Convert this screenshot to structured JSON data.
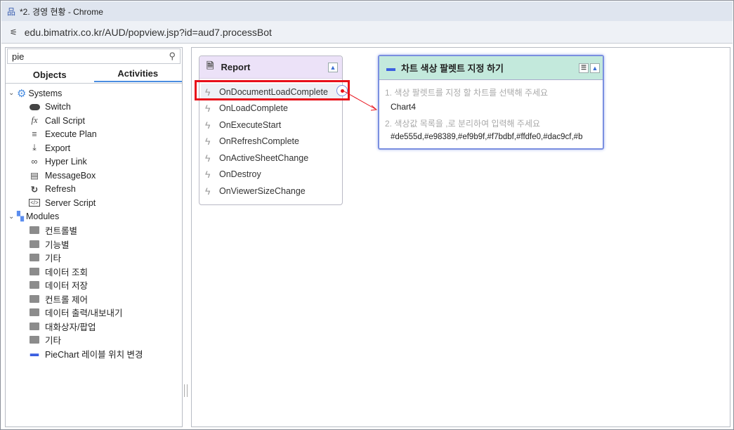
{
  "window": {
    "title": "*2. 경영 현황 - Chrome",
    "url": "edu.bimatrix.co.kr/AUD/popview.jsp?id=aud7.processBot"
  },
  "left": {
    "search_value": "pie",
    "tabs": [
      "Objects",
      "Activities"
    ],
    "systems": {
      "label": "Systems",
      "items": [
        "Switch",
        "Call Script",
        "Execute Plan",
        "Export",
        "Hyper Link",
        "MessageBox",
        "Refresh",
        "Server Script"
      ]
    },
    "modules": {
      "label": "Modules",
      "items": [
        "컨트롤별",
        "기능별",
        "기타",
        "데이터 조회",
        "데이터 저장",
        "컨트롤 제어",
        "데이터 출력/내보내기",
        "대화상자/팝업",
        "기타"
      ],
      "leaf": "PieChart 레이블 위치 변경"
    }
  },
  "report": {
    "title": "Report",
    "events": [
      "OnDocumentLoadComplete",
      "OnLoadComplete",
      "OnExecuteStart",
      "OnRefreshComplete",
      "OnActiveSheetChange",
      "OnDestroy",
      "OnViewerSizeChange"
    ]
  },
  "chart_node": {
    "title": "차트 색상 팔렛트 지정 하기",
    "prompt1": "1. 색상 팔렛트를 지정 할 차트를 선택해 주세요",
    "value1": "Chart4",
    "prompt2": "2. 색상값 목록을 ,로 분리하여 입력해 주세요",
    "value2": "#de555d,#e98389,#ef9b9f,#f7bdbf,#ffdfe0,#dac9cf,#b"
  },
  "colors": {
    "highlight": "#e8101a",
    "accent": "#4a8de0"
  }
}
